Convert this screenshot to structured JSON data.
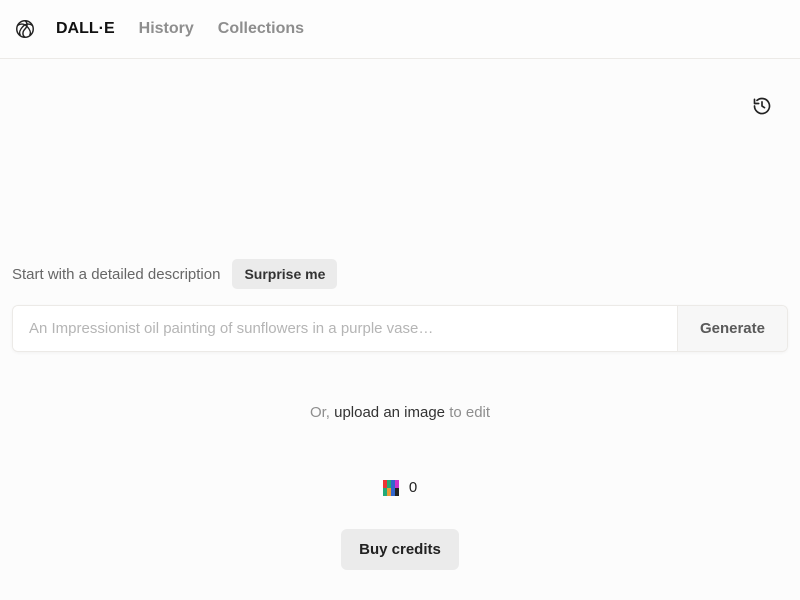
{
  "header": {
    "nav": {
      "items": [
        {
          "label": "DALL·E",
          "active": true
        },
        {
          "label": "History",
          "active": false
        },
        {
          "label": "Collections",
          "active": false
        }
      ]
    }
  },
  "prompt": {
    "intro_label": "Start with a detailed description",
    "surprise_label": "Surprise me",
    "placeholder": "An Impressionist oil painting of sunflowers in a purple vase…",
    "value": "",
    "generate_label": "Generate"
  },
  "upload": {
    "prefix": "Or, ",
    "link": "upload an image",
    "suffix": " to edit"
  },
  "credits": {
    "count": "0",
    "buy_label": "Buy credits"
  }
}
